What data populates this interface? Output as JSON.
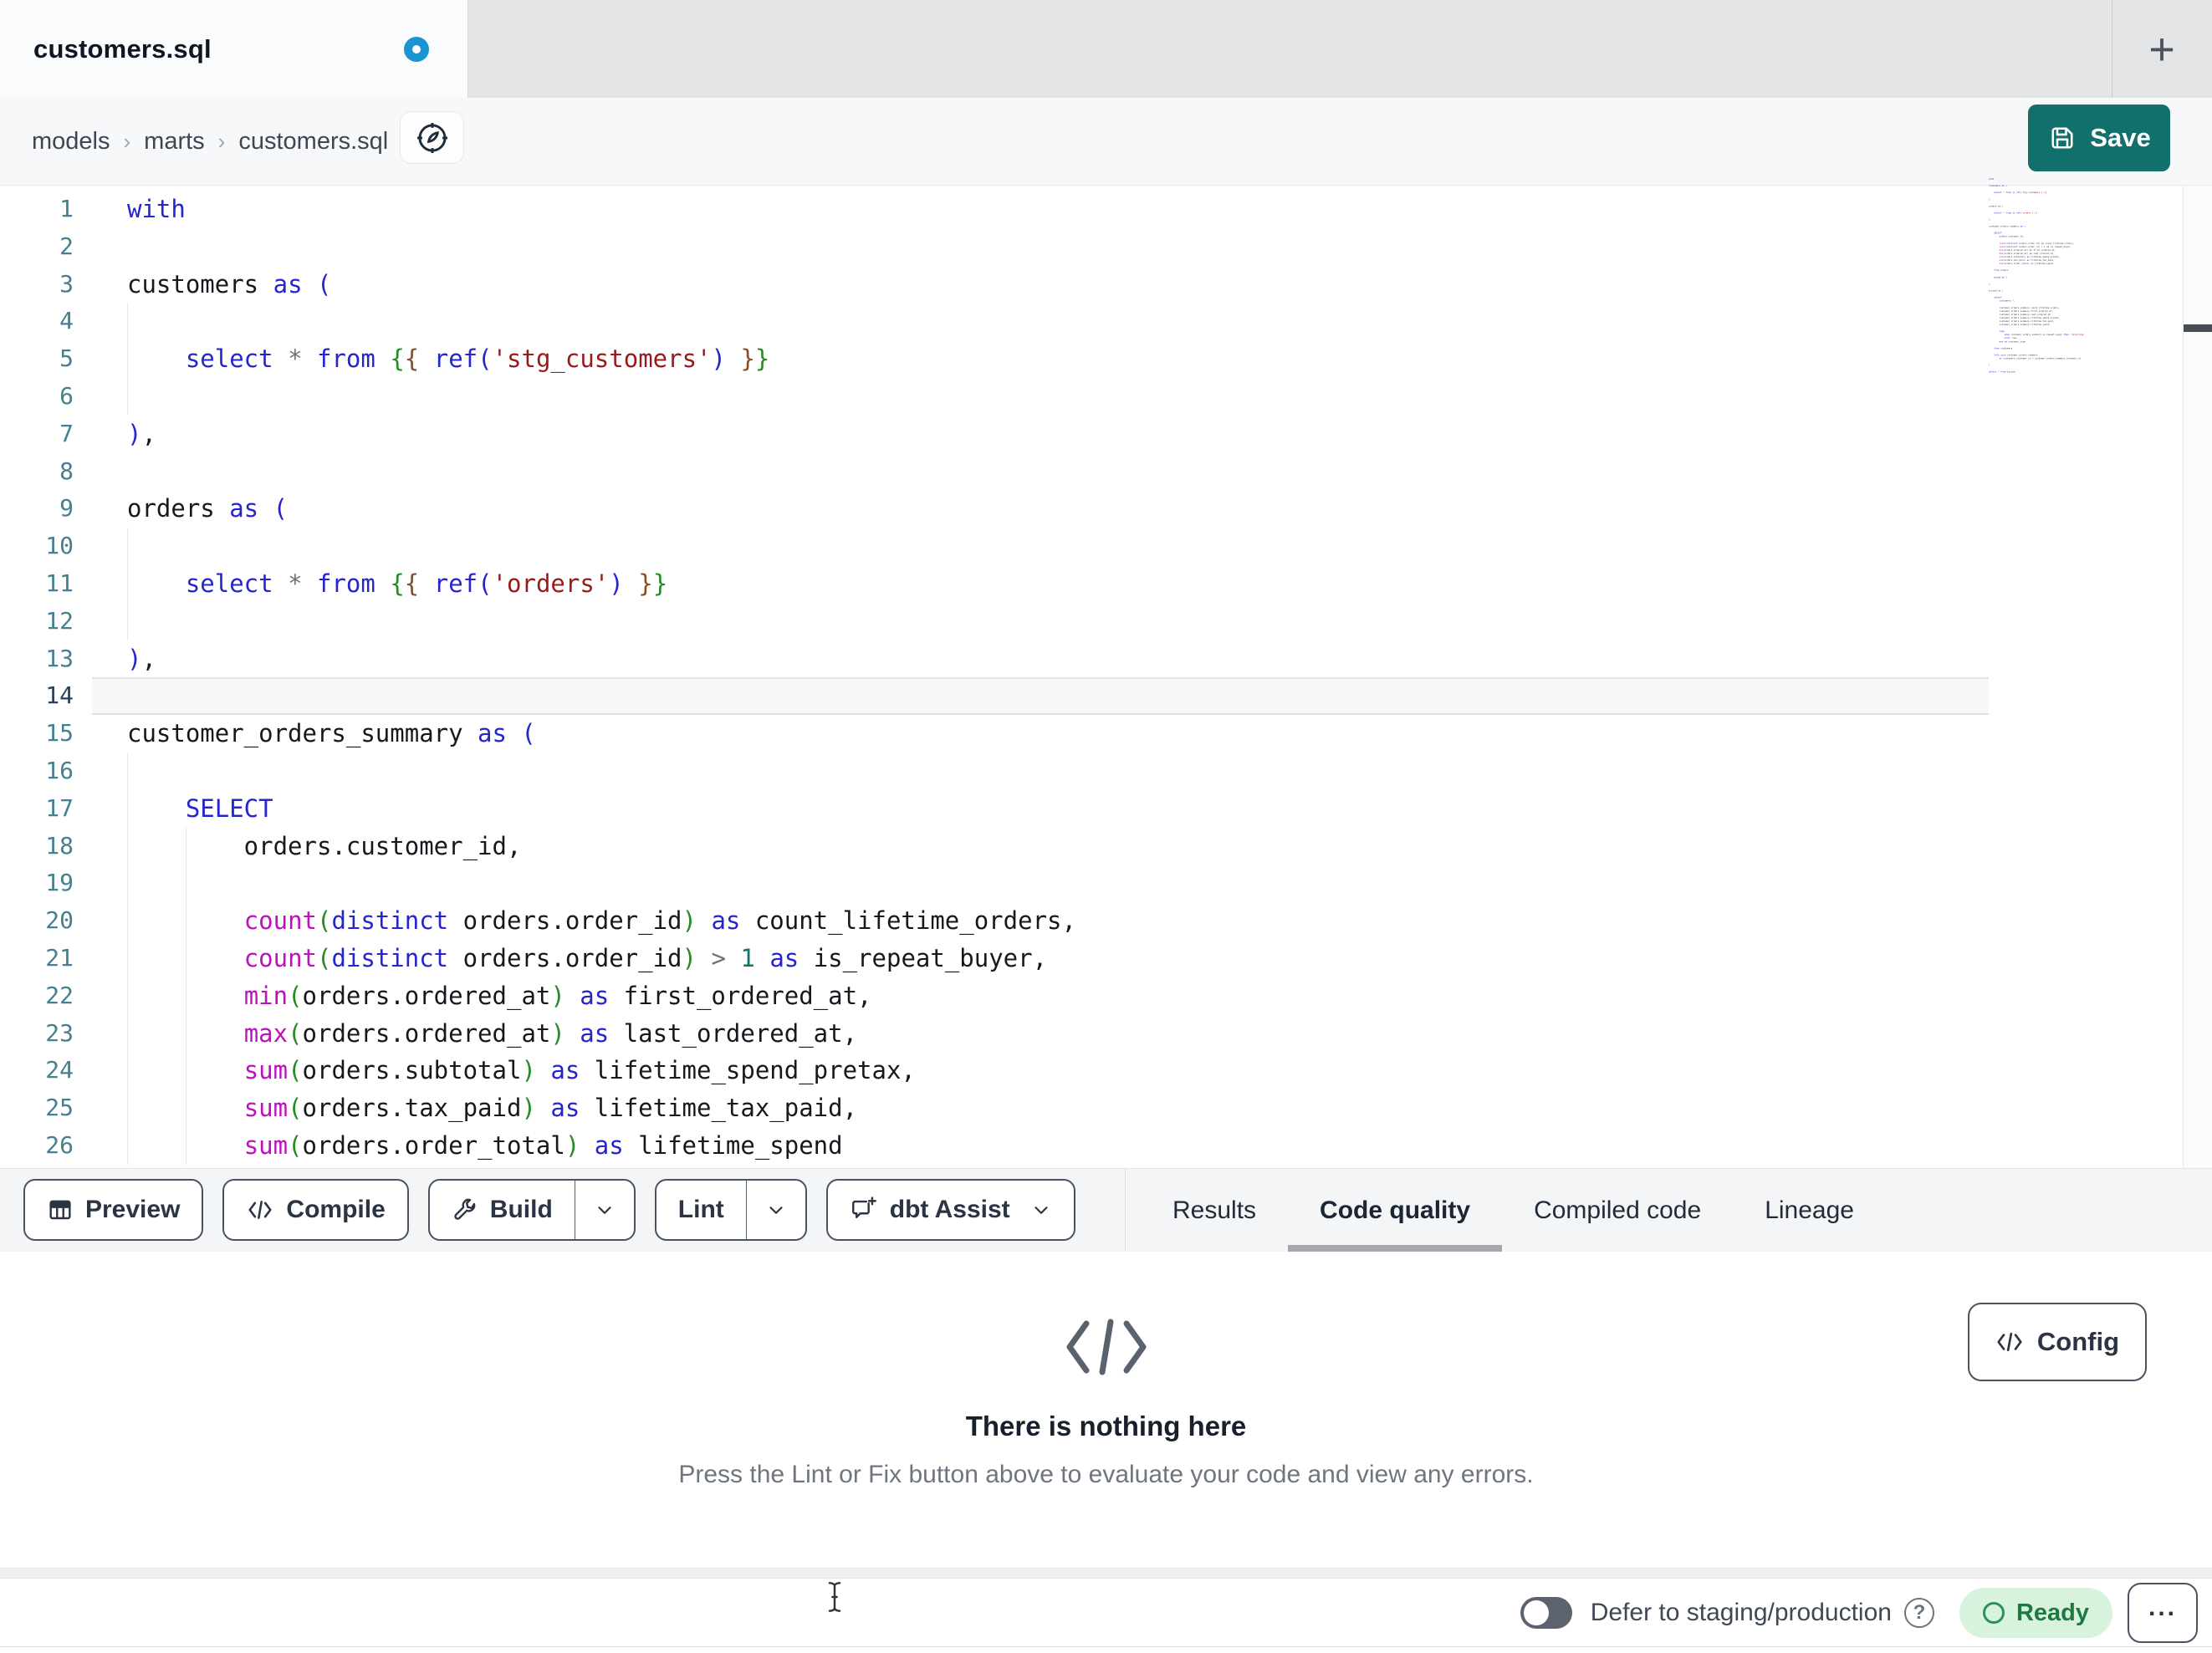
{
  "window": {
    "tab_title": "customers.sql",
    "new_tab": "+"
  },
  "breadcrumb": {
    "items": [
      "models",
      "marts",
      "customers.sql"
    ],
    "separator": "›"
  },
  "actions": {
    "save": "Save"
  },
  "editor": {
    "active_line": 14,
    "lines": [
      {
        "n": 1,
        "g": [],
        "t": [
          [
            "kw",
            "with"
          ]
        ]
      },
      {
        "n": 2,
        "g": [],
        "t": []
      },
      {
        "n": 3,
        "g": [],
        "t": [
          [
            "pl",
            "customers "
          ],
          [
            "kw",
            "as"
          ],
          [
            "pl",
            " "
          ],
          [
            "b1",
            "("
          ]
        ]
      },
      {
        "n": 4,
        "g": [
          0
        ],
        "t": []
      },
      {
        "n": 5,
        "g": [
          0
        ],
        "t": [
          [
            "pl",
            "    "
          ],
          [
            "kw",
            "select"
          ],
          [
            "pl",
            " "
          ],
          [
            "op",
            "*"
          ],
          [
            "pl",
            " "
          ],
          [
            "kw",
            "from"
          ],
          [
            "pl",
            " "
          ],
          [
            "b2",
            "{"
          ],
          [
            "b3",
            "{"
          ],
          [
            "pl",
            " "
          ],
          [
            "kw",
            "ref"
          ],
          [
            "b1",
            "("
          ],
          [
            "str",
            "'stg_customers'"
          ],
          [
            "b1",
            ")"
          ],
          [
            "pl",
            " "
          ],
          [
            "b3",
            "}"
          ],
          [
            "b2",
            "}"
          ]
        ]
      },
      {
        "n": 6,
        "g": [
          0
        ],
        "t": []
      },
      {
        "n": 7,
        "g": [],
        "t": [
          [
            "b1",
            ")"
          ],
          [
            "pl",
            ","
          ]
        ]
      },
      {
        "n": 8,
        "g": [],
        "t": []
      },
      {
        "n": 9,
        "g": [],
        "t": [
          [
            "pl",
            "orders "
          ],
          [
            "kw",
            "as"
          ],
          [
            "pl",
            " "
          ],
          [
            "b1",
            "("
          ]
        ]
      },
      {
        "n": 10,
        "g": [
          0
        ],
        "t": []
      },
      {
        "n": 11,
        "g": [
          0
        ],
        "t": [
          [
            "pl",
            "    "
          ],
          [
            "kw",
            "select"
          ],
          [
            "pl",
            " "
          ],
          [
            "op",
            "*"
          ],
          [
            "pl",
            " "
          ],
          [
            "kw",
            "from"
          ],
          [
            "pl",
            " "
          ],
          [
            "b2",
            "{"
          ],
          [
            "b3",
            "{"
          ],
          [
            "pl",
            " "
          ],
          [
            "kw",
            "ref"
          ],
          [
            "b1",
            "("
          ],
          [
            "str",
            "'orders'"
          ],
          [
            "b1",
            ")"
          ],
          [
            "pl",
            " "
          ],
          [
            "b3",
            "}"
          ],
          [
            "b2",
            "}"
          ]
        ]
      },
      {
        "n": 12,
        "g": [
          0
        ],
        "t": []
      },
      {
        "n": 13,
        "g": [],
        "t": [
          [
            "b1",
            ")"
          ],
          [
            "pl",
            ","
          ]
        ]
      },
      {
        "n": 14,
        "g": [],
        "t": []
      },
      {
        "n": 15,
        "g": [],
        "t": [
          [
            "pl",
            "customer_orders_summary "
          ],
          [
            "kw",
            "as"
          ],
          [
            "pl",
            " "
          ],
          [
            "b1",
            "("
          ]
        ]
      },
      {
        "n": 16,
        "g": [
          0
        ],
        "t": []
      },
      {
        "n": 17,
        "g": [
          0
        ],
        "t": [
          [
            "pl",
            "    "
          ],
          [
            "kw",
            "SELECT"
          ]
        ]
      },
      {
        "n": 18,
        "g": [
          0,
          1
        ],
        "t": [
          [
            "pl",
            "        orders.customer_id,"
          ]
        ]
      },
      {
        "n": 19,
        "g": [
          0,
          1
        ],
        "t": []
      },
      {
        "n": 20,
        "g": [
          0,
          1
        ],
        "t": [
          [
            "pl",
            "        "
          ],
          [
            "fn",
            "count"
          ],
          [
            "b2",
            "("
          ],
          [
            "kw",
            "distinct"
          ],
          [
            "pl",
            " orders.order_id"
          ],
          [
            "b2",
            ")"
          ],
          [
            "pl",
            " "
          ],
          [
            "kw",
            "as"
          ],
          [
            "pl",
            " count_lifetime_orders,"
          ]
        ]
      },
      {
        "n": 21,
        "g": [
          0,
          1
        ],
        "t": [
          [
            "pl",
            "        "
          ],
          [
            "fn",
            "count"
          ],
          [
            "b2",
            "("
          ],
          [
            "kw",
            "distinct"
          ],
          [
            "pl",
            " orders.order_id"
          ],
          [
            "b2",
            ")"
          ],
          [
            "pl",
            " "
          ],
          [
            "op",
            ">"
          ],
          [
            "pl",
            " "
          ],
          [
            "num",
            "1"
          ],
          [
            "pl",
            " "
          ],
          [
            "kw",
            "as"
          ],
          [
            "pl",
            " is_repeat_buyer,"
          ]
        ]
      },
      {
        "n": 22,
        "g": [
          0,
          1
        ],
        "t": [
          [
            "pl",
            "        "
          ],
          [
            "fn",
            "min"
          ],
          [
            "b2",
            "("
          ],
          [
            "pl",
            "orders.ordered_at"
          ],
          [
            "b2",
            ")"
          ],
          [
            "pl",
            " "
          ],
          [
            "kw",
            "as"
          ],
          [
            "pl",
            " first_ordered_at,"
          ]
        ]
      },
      {
        "n": 23,
        "g": [
          0,
          1
        ],
        "t": [
          [
            "pl",
            "        "
          ],
          [
            "fn",
            "max"
          ],
          [
            "b2",
            "("
          ],
          [
            "pl",
            "orders.ordered_at"
          ],
          [
            "b2",
            ")"
          ],
          [
            "pl",
            " "
          ],
          [
            "kw",
            "as"
          ],
          [
            "pl",
            " last_ordered_at,"
          ]
        ]
      },
      {
        "n": 24,
        "g": [
          0,
          1
        ],
        "t": [
          [
            "pl",
            "        "
          ],
          [
            "fn",
            "sum"
          ],
          [
            "b2",
            "("
          ],
          [
            "pl",
            "orders.subtotal"
          ],
          [
            "b2",
            ")"
          ],
          [
            "pl",
            " "
          ],
          [
            "kw",
            "as"
          ],
          [
            "pl",
            " lifetime_spend_pretax,"
          ]
        ]
      },
      {
        "n": 25,
        "g": [
          0,
          1
        ],
        "t": [
          [
            "pl",
            "        "
          ],
          [
            "fn",
            "sum"
          ],
          [
            "b2",
            "("
          ],
          [
            "pl",
            "orders.tax_paid"
          ],
          [
            "b2",
            ")"
          ],
          [
            "pl",
            " "
          ],
          [
            "kw",
            "as"
          ],
          [
            "pl",
            " lifetime_tax_paid,"
          ]
        ]
      },
      {
        "n": 26,
        "g": [
          0,
          1
        ],
        "t": [
          [
            "pl",
            "        "
          ],
          [
            "fn",
            "sum"
          ],
          [
            "b2",
            "("
          ],
          [
            "pl",
            "orders.order_total"
          ],
          [
            "b2",
            ")"
          ],
          [
            "pl",
            " "
          ],
          [
            "kw",
            "as"
          ],
          [
            "pl",
            " lifetime_spend"
          ]
        ]
      }
    ],
    "minimap_lines": [
      "with",
      "",
      "customers as (",
      "",
      "    select * from {{ ref('stg_customers') }}",
      "",
      "),",
      "",
      "orders as (",
      "",
      "    select * from {{ ref('orders') }}",
      "",
      "),",
      "",
      "customer_orders_summary as (",
      "",
      "    SELECT",
      "        orders.customer_id,",
      "",
      "        count(distinct orders.order_id) as count_lifetime_orders,",
      "        count(distinct orders.order_id) > 1 as is_repeat_buyer,",
      "        min(orders.ordered_at) as first_ordered_at,",
      "        max(orders.ordered_at) as last_ordered_at,",
      "        sum(orders.subtotal) as lifetime_spend_pretax,",
      "        sum(orders.tax_paid) as lifetime_tax_paid,",
      "        sum(orders.order_total) as lifetime_spend",
      "",
      "    from orders",
      "",
      "    group by 1",
      "",
      "),",
      "",
      "joined as (",
      "",
      "    select",
      "        customers.*,",
      "",
      "        customer_orders_summary.count_lifetime_orders,",
      "        customer_orders_summary.first_ordered_at,",
      "        customer_orders_summary.last_ordered_at,",
      "        customer_orders_summary.lifetime_spend_pretax,",
      "        customer_orders_summary.lifetime_tax_paid,",
      "        customer_orders_summary.lifetime_spend,",
      "",
      "        case",
      "            when customer_orders_summary.is_repeat_buyer then 'returning'",
      "            else 'new'",
      "        end as customer_type",
      "",
      "    from customers",
      "",
      "    left join customer_orders_summary",
      "        on customers.customer_id = customer_orders_summary.customer_id",
      "",
      ")",
      "",
      "select * from joined"
    ]
  },
  "toolbar": {
    "preview": "Preview",
    "compile": "Compile",
    "build": "Build",
    "lint": "Lint",
    "assist": "dbt Assist"
  },
  "tabs": [
    {
      "label": "Results",
      "active": false
    },
    {
      "label": "Code quality",
      "active": true
    },
    {
      "label": "Compiled code",
      "active": false
    },
    {
      "label": "Lineage",
      "active": false
    }
  ],
  "panel": {
    "title": "There is nothing here",
    "subtitle": "Press the Lint or Fix button above to evaluate your code and view any errors.",
    "config": "Config"
  },
  "statusbar": {
    "defer_label": "Defer to staging/production",
    "ready": "Ready"
  },
  "icons": {
    "unsaved-dot": "blue donut",
    "compass-icon": "compass",
    "save-icon": "floppy-disk",
    "preview-icon": "table-grid",
    "compile-icon": "code-brackets",
    "build-icon": "wrench",
    "assist-icon": "chat-bubble-sparkle",
    "chevron-down-icon": "⌄",
    "empty-code-icon": "</>",
    "config-code-icon": "</>",
    "help-icon": "?",
    "more-icon": "•••",
    "text-cursor": "I-beam"
  },
  "colors": {
    "accent_teal": "#12706c",
    "unsaved_blue": "#1b95d2",
    "ready_green": "#1d7a3e",
    "ready_bg": "#d7f3de",
    "tabbar_bg": "#e4e5e7",
    "keyword_blue": "#2525cf",
    "function_magenta": "#bf0fbf",
    "string_red": "#9a1a1a"
  }
}
